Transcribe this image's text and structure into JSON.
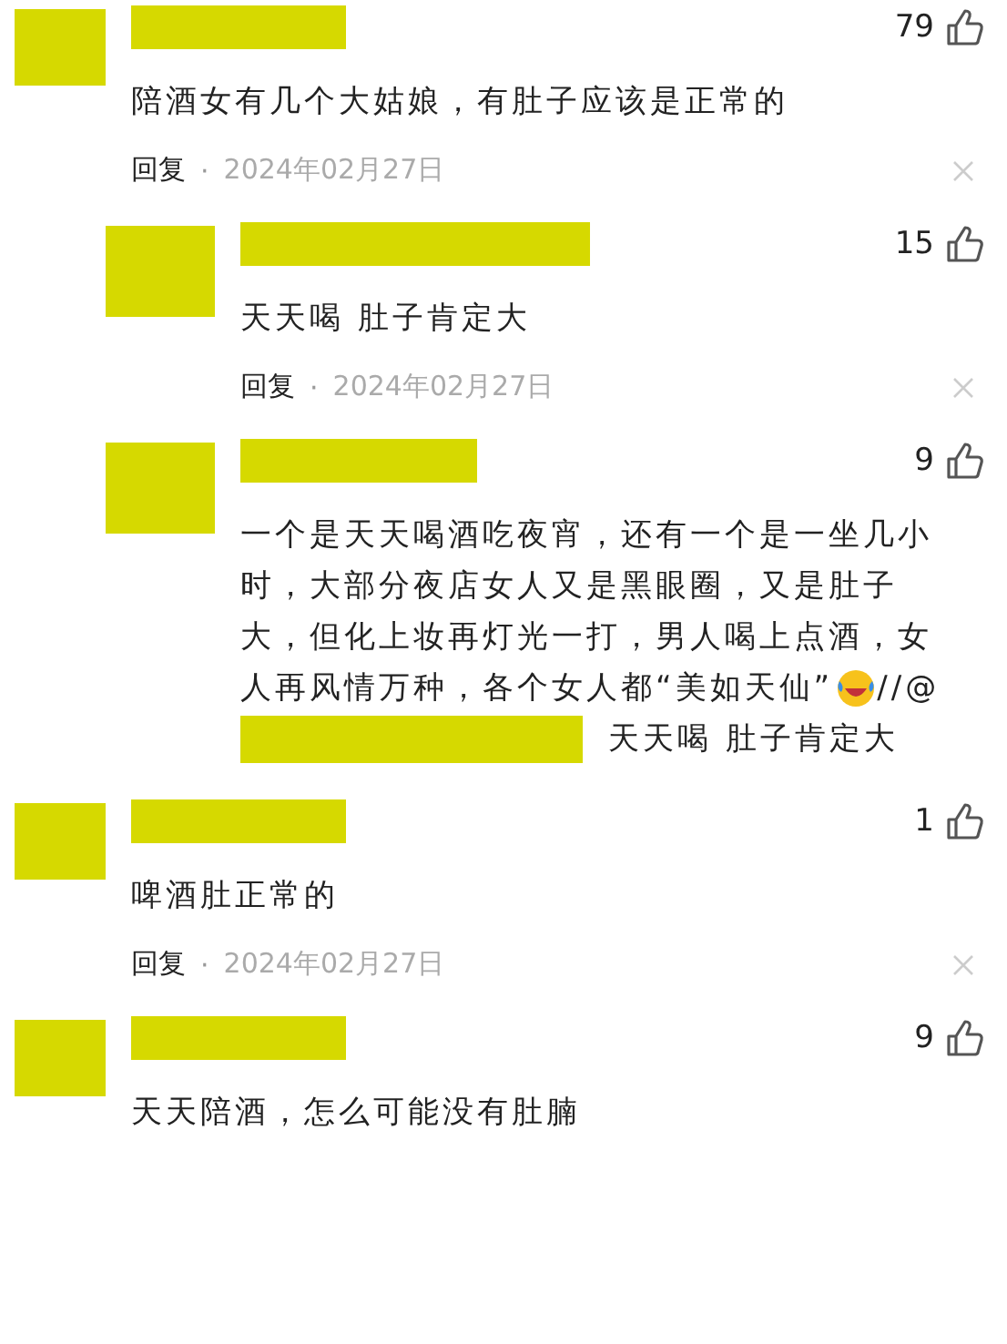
{
  "comments": [
    {
      "likes": "79",
      "lines": [
        [
          {
            "kind": "text",
            "text": "陪酒女有几个大姑娘，有肚子应该是正常的"
          }
        ]
      ],
      "reply_label": "回复",
      "separator": "·",
      "date": "2024年02月27日",
      "children": [
        {
          "likes": "15",
          "lines": [
            [
              {
                "kind": "text",
                "text": "天天喝 肚子肯定大"
              }
            ]
          ],
          "reply_label": "回复",
          "separator": "·",
          "date": "2024年02月27日"
        },
        {
          "likes": "9",
          "lines": [
            [
              {
                "kind": "text",
                "text": "一个是天天喝酒吃夜宵，还有一个是一坐几小时，大部分夜店女人又是黑眼圈，又是肚子大，但化上妆再灯光一打，男人喝上点酒，女"
              }
            ],
            [
              {
                "kind": "text",
                "text": "人再风情万种，各个女人都“美如天仙”"
              },
              {
                "kind": "emoji"
              },
              {
                "kind": "text",
                "text": "//@"
              }
            ],
            [
              {
                "kind": "redaction"
              },
              {
                "kind": "text",
                "text": "天天喝 肚子肯定大"
              }
            ]
          ]
        }
      ]
    },
    {
      "likes": "1",
      "lines": [
        [
          {
            "kind": "text",
            "text": "啤酒肚正常的"
          }
        ]
      ],
      "reply_label": "回复",
      "separator": "·",
      "date": "2024年02月27日"
    },
    {
      "likes": "9",
      "lines": [
        [
          {
            "kind": "text",
            "text": "天天陪酒，怎么可能没有肚腩"
          }
        ]
      ]
    }
  ]
}
